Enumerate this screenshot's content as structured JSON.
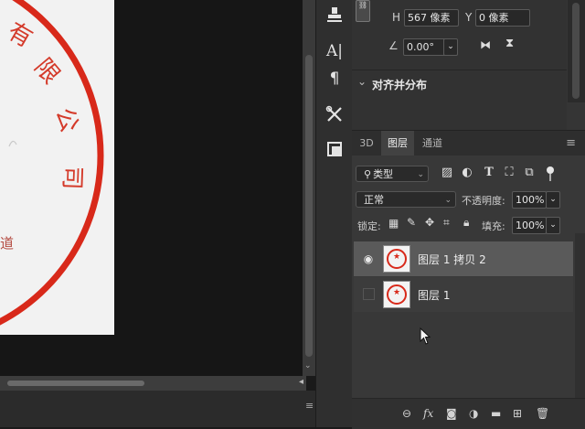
{
  "document": {
    "stamp_text": "有限公司",
    "stamp_bottom_char": "道",
    "stamp_color": "#d8291a"
  },
  "properties": {
    "link_icon": "link-icon",
    "h_label": "H",
    "h_value": "567 像素",
    "y_label": "Y",
    "y_value": "0 像素",
    "angle_value": "0.00°",
    "align_section_title": "对齐并分布"
  },
  "tools": [
    "stamp-icon",
    "type-icon",
    "paragraph-icon",
    "settings-tool-icon",
    "clone-panel-icon"
  ],
  "layers_panel": {
    "tabs": [
      {
        "label": "3D",
        "active": false
      },
      {
        "label": "图层",
        "active": true
      },
      {
        "label": "通道",
        "active": false
      }
    ],
    "filter": {
      "label": "类型",
      "icons": [
        "image-filter-icon",
        "adjustment-filter-icon",
        "type-filter-icon",
        "shape-filter-icon",
        "smart-object-filter-icon"
      ]
    },
    "blend_mode": "正常",
    "opacity_label": "不透明度:",
    "opacity_value": "100%",
    "lock_label": "锁定:",
    "fill_label": "填充:",
    "fill_value": "100%",
    "layers": [
      {
        "name": "图层 1 拷贝 2",
        "visible": true,
        "selected": true
      },
      {
        "name": "图层 1",
        "visible": false,
        "selected": false
      }
    ],
    "footer_icons": [
      "link-layers-icon",
      "fx-icon",
      "mask-icon",
      "adjustment-icon",
      "folder-icon",
      "new-layer-icon",
      "trash-icon"
    ]
  },
  "colors": {
    "accent_red": "#d8291a",
    "panel_bg": "#353535",
    "selected_row": "#5a5a5a"
  }
}
